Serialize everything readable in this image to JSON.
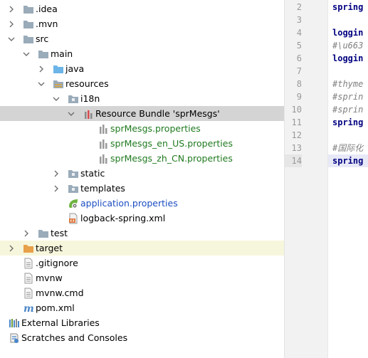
{
  "tree": [
    {
      "id": "idea",
      "label": ".idea",
      "arrow": "right",
      "indent": 0,
      "icon": "folder-icon",
      "color": "default"
    },
    {
      "id": "mvn",
      "label": ".mvn",
      "arrow": "right",
      "indent": 0,
      "icon": "folder-icon",
      "color": "default"
    },
    {
      "id": "src",
      "label": "src",
      "arrow": "down",
      "indent": 0,
      "icon": "folder-icon",
      "color": "default"
    },
    {
      "id": "main",
      "label": "main",
      "arrow": "down",
      "indent": 1,
      "icon": "folder-icon",
      "color": "default"
    },
    {
      "id": "java",
      "label": "java",
      "arrow": "right",
      "indent": 2,
      "icon": "source-folder-icon",
      "color": "default"
    },
    {
      "id": "resources",
      "label": "resources",
      "arrow": "down",
      "indent": 2,
      "icon": "resources-folder-icon",
      "color": "default"
    },
    {
      "id": "i18n",
      "label": "i18n",
      "arrow": "down",
      "indent": 3,
      "icon": "package-folder-icon",
      "color": "default"
    },
    {
      "id": "bundle",
      "label": "Resource Bundle 'sprMesgs'",
      "arrow": "down",
      "indent": 4,
      "icon": "resource-bundle-icon",
      "color": "default",
      "selected": true
    },
    {
      "id": "p1",
      "label": "sprMesgs.properties",
      "arrow": "none",
      "indent": 5,
      "icon": "properties-icon",
      "color": "green"
    },
    {
      "id": "p2",
      "label": "sprMesgs_en_US.properties",
      "arrow": "none",
      "indent": 5,
      "icon": "properties-icon",
      "color": "green"
    },
    {
      "id": "p3",
      "label": "sprMesgs_zh_CN.properties",
      "arrow": "none",
      "indent": 5,
      "icon": "properties-icon",
      "color": "green"
    },
    {
      "id": "static",
      "label": "static",
      "arrow": "right",
      "indent": 3,
      "icon": "package-folder-icon",
      "color": "default"
    },
    {
      "id": "templates",
      "label": "templates",
      "arrow": "right",
      "indent": 3,
      "icon": "package-folder-icon",
      "color": "default"
    },
    {
      "id": "appprops",
      "label": "application.properties",
      "arrow": "none",
      "indent": 3,
      "icon": "spring-properties-icon",
      "color": "blue"
    },
    {
      "id": "logback",
      "label": "logback-spring.xml",
      "arrow": "none",
      "indent": 3,
      "icon": "xml-file-icon",
      "color": "default"
    },
    {
      "id": "test",
      "label": "test",
      "arrow": "right",
      "indent": 1,
      "icon": "folder-icon",
      "color": "default"
    },
    {
      "id": "target",
      "label": "target",
      "arrow": "right",
      "indent": 0,
      "icon": "excluded-folder-icon",
      "color": "default",
      "highlight": true
    },
    {
      "id": "gitignore",
      "label": ".gitignore",
      "arrow": "none",
      "indent": 0,
      "icon": "text-file-icon",
      "color": "default"
    },
    {
      "id": "mvnw",
      "label": "mvnw",
      "arrow": "none",
      "indent": 0,
      "icon": "text-file-icon",
      "color": "default"
    },
    {
      "id": "mvnwcmd",
      "label": "mvnw.cmd",
      "arrow": "none",
      "indent": 0,
      "icon": "text-file-icon",
      "color": "default"
    },
    {
      "id": "pom",
      "label": "pom.xml",
      "arrow": "none",
      "indent": 0,
      "icon": "maven-icon",
      "color": "default"
    },
    {
      "id": "extlib",
      "label": "External Libraries",
      "arrow": "none",
      "indent": -1,
      "icon": "libraries-icon",
      "color": "default"
    },
    {
      "id": "scratches",
      "label": "Scratches and Consoles",
      "arrow": "none",
      "indent": -1,
      "icon": "scratches-icon",
      "color": "default"
    }
  ],
  "editor": {
    "lines": [
      {
        "num": "2",
        "text": "spring",
        "style": "kw"
      },
      {
        "num": "3",
        "text": "",
        "style": ""
      },
      {
        "num": "4",
        "text": "loggin",
        "style": "kw"
      },
      {
        "num": "5",
        "text": "#\\u663",
        "style": "cm"
      },
      {
        "num": "6",
        "text": "loggin",
        "style": "kw"
      },
      {
        "num": "7",
        "text": "",
        "style": ""
      },
      {
        "num": "8",
        "text": "#thyme",
        "style": "cm"
      },
      {
        "num": "9",
        "text": "#sprin",
        "style": "cm"
      },
      {
        "num": "10",
        "text": "#sprin",
        "style": "cm"
      },
      {
        "num": "11",
        "text": "spring",
        "style": "kw"
      },
      {
        "num": "12",
        "text": "",
        "style": ""
      },
      {
        "num": "13",
        "text": "#国际化",
        "style": "cm"
      },
      {
        "num": "14",
        "text": "spring",
        "style": "kw",
        "current": true
      }
    ]
  },
  "colors": {
    "selection": "#d4d4d4",
    "highlight": "#f6f6dc",
    "green_text": "#1f7a1f",
    "blue_text": "#1c4ec2",
    "folder": "#8fa4b5",
    "excluded_folder": "#e8a049"
  }
}
